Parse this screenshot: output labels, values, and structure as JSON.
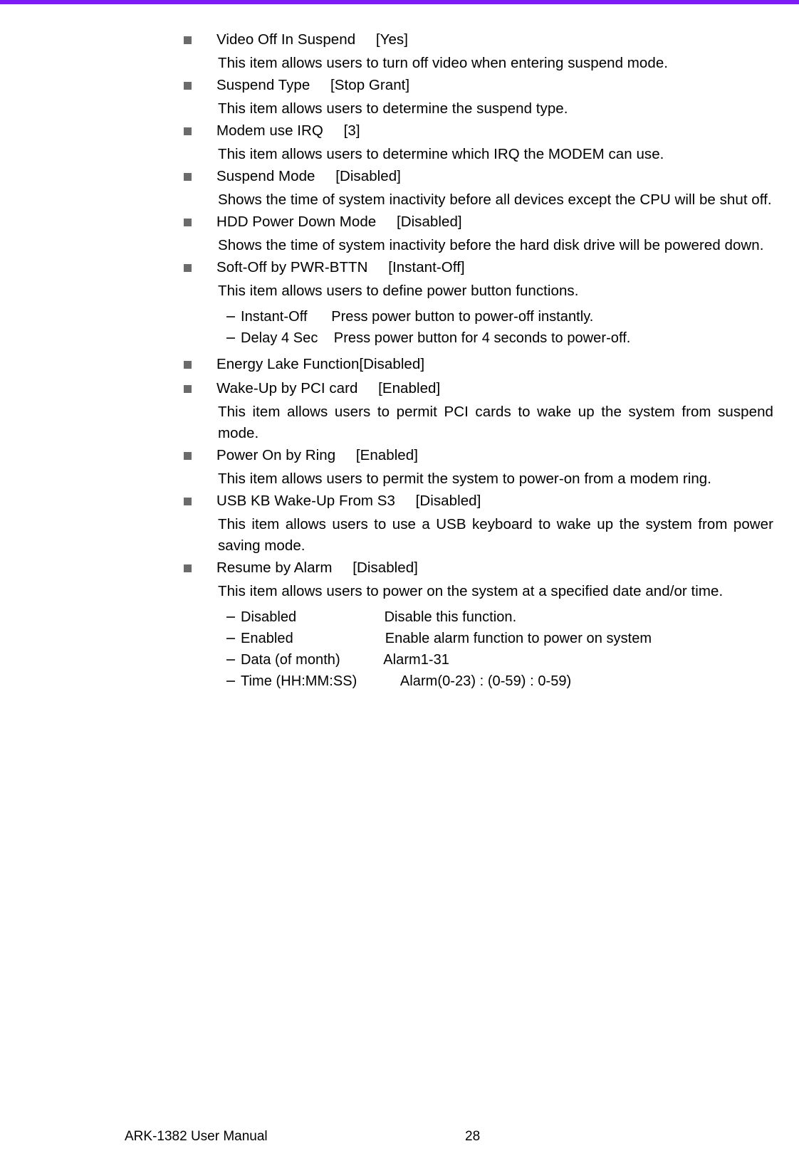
{
  "theme": {
    "accent_bar_color": "#7d1cf5",
    "bullet_color": "#6b6b6b",
    "text_color": "#000000"
  },
  "page": {
    "entries": [
      {
        "title": "Video Off In Suspend     [Yes]",
        "desc": "This item allows users to turn off video when entering suspend mode.",
        "justify": false,
        "sublist": []
      },
      {
        "title": "Suspend Type     [Stop Grant]",
        "desc": "This item allows users to determine the suspend type.",
        "justify": false,
        "sublist": []
      },
      {
        "title": "Modem use IRQ     [3]",
        "desc": "This item allows users to determine which IRQ the MODEM can use.",
        "justify": false,
        "sublist": []
      },
      {
        "title": "Suspend Mode     [Disabled]",
        "desc": "Shows the time of system inactivity before all devices except the CPU will be shut off.",
        "justify": true,
        "sublist": []
      },
      {
        "title": "HDD Power Down Mode     [Disabled]",
        "desc": "Shows the time of system inactivity before the hard disk drive will be powered down.",
        "justify": true,
        "sublist": []
      },
      {
        "title": "Soft-Off by PWR-BTTN     [Instant-Off]",
        "desc": "This item allows users to define power button functions.",
        "justify": false,
        "sublist": [
          "Instant-Off      Press power button to power-off instantly.",
          "Delay 4 Sec    Press power button for 4 seconds to power-off."
        ]
      },
      {
        "title": "Energy Lake Function[Disabled]",
        "desc": "",
        "justify": false,
        "sublist": []
      },
      {
        "title": "Wake-Up by PCI card     [Enabled]",
        "desc": "This item allows users to permit PCI cards to wake up the system from suspend mode.",
        "justify": true,
        "sublist": []
      },
      {
        "title": "Power On by Ring     [Enabled]",
        "desc": "This item allows users to permit the system to power-on from a modem ring.",
        "justify": false,
        "sublist": []
      },
      {
        "title": "USB KB Wake-Up From S3     [Disabled]",
        "desc": "This item allows users to use a USB keyboard to wake up the system from power saving mode.",
        "justify": true,
        "sublist": []
      },
      {
        "title": "Resume by Alarm     [Disabled]",
        "desc": "This item allows users to power on the system at a specified date and/or time.",
        "justify": false,
        "sublist": [
          "Disabled                      Disable this function.",
          "Enabled                       Enable alarm function to power on system",
          "Data (of month)           Alarm1-31",
          "Time (HH:MM:SS)           Alarm(0-23) : (0-59) : 0-59)"
        ]
      }
    ]
  },
  "footer": {
    "manual_title": "ARK-1382 User Manual",
    "page_number": "28"
  }
}
